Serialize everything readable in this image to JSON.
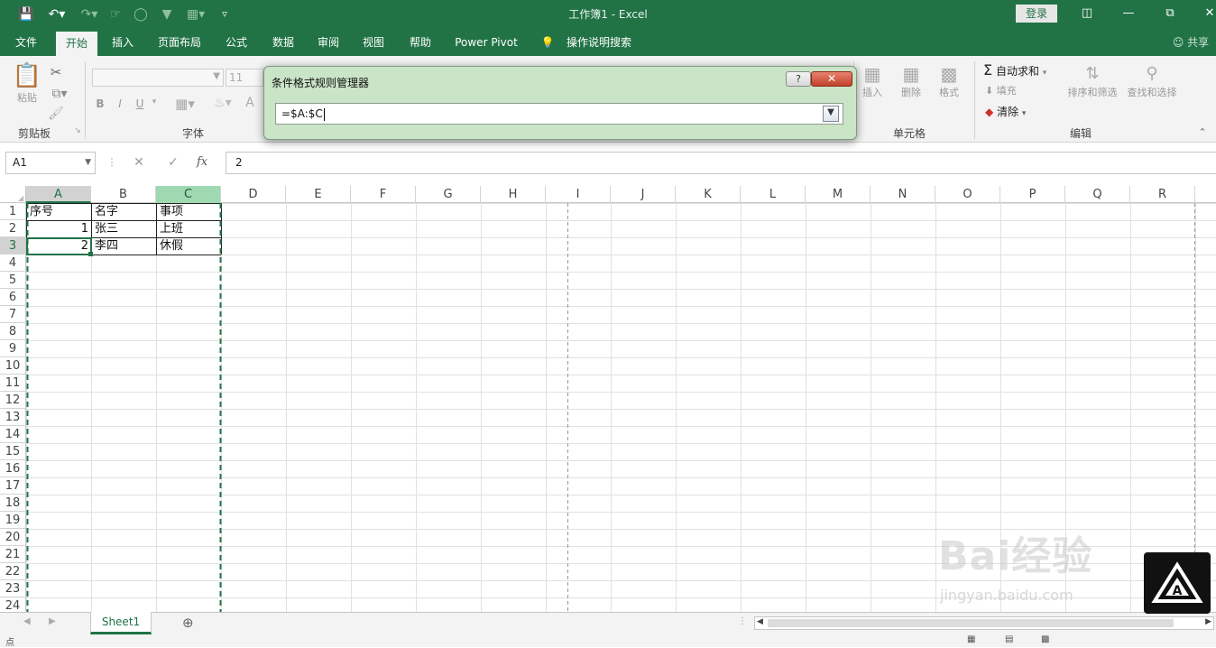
{
  "titlebar": {
    "title": "工作簿1  -  Excel",
    "login_label": "登录",
    "qat": {
      "save_icon": "save-icon",
      "undo_icon": "undo-icon",
      "redo_icon": "redo-icon"
    }
  },
  "ribbon_tabs": [
    "文件",
    "开始",
    "插入",
    "页面布局",
    "公式",
    "数据",
    "审阅",
    "视图",
    "帮助",
    "Power Pivot",
    "操作说明搜索"
  ],
  "share_label": "共享",
  "ribbon": {
    "clipboard": {
      "label": "剪贴板",
      "paste": "粘贴"
    },
    "font": {
      "label": "字体",
      "size": "11",
      "bold": "B",
      "italic": "I",
      "underline": "U",
      "a": "A"
    },
    "cells": {
      "label": "单元格",
      "insert": "插入",
      "delete": "删除",
      "format": "格式"
    },
    "editing": {
      "label": "编辑",
      "autosum": "自动求和",
      "fill": "填充",
      "clear": "清除",
      "sort": "排序和筛选",
      "find": "查找和选择"
    }
  },
  "formula_bar": {
    "name_box": "A1",
    "fx": "fx",
    "value": "2"
  },
  "columns": [
    "A",
    "B",
    "C",
    "D",
    "E",
    "F",
    "G",
    "H",
    "I",
    "J",
    "K",
    "L",
    "M",
    "N",
    "O",
    "P",
    "Q",
    "R"
  ],
  "rows": [
    "1",
    "2",
    "3",
    "4",
    "5",
    "6",
    "7",
    "8",
    "9",
    "10",
    "11",
    "12",
    "13",
    "14",
    "15",
    "16",
    "17",
    "18",
    "19",
    "20",
    "21",
    "22",
    "23",
    "24"
  ],
  "cells": {
    "a1": "序号",
    "b1": "名字",
    "c1": "事项",
    "a2": "1",
    "b2": "张三",
    "c2": "上班",
    "a3": "2",
    "b3": "李四",
    "c3": "休假"
  },
  "sheet_tab": "Sheet1",
  "status": {
    "ready": "点"
  },
  "dialog": {
    "title": "条件格式规则管理器",
    "help": "?",
    "close": "✕",
    "input_value": "=$A:$C"
  },
  "watermark": {
    "text": "Bai经验",
    "url": "jingyan.baidu.com"
  }
}
